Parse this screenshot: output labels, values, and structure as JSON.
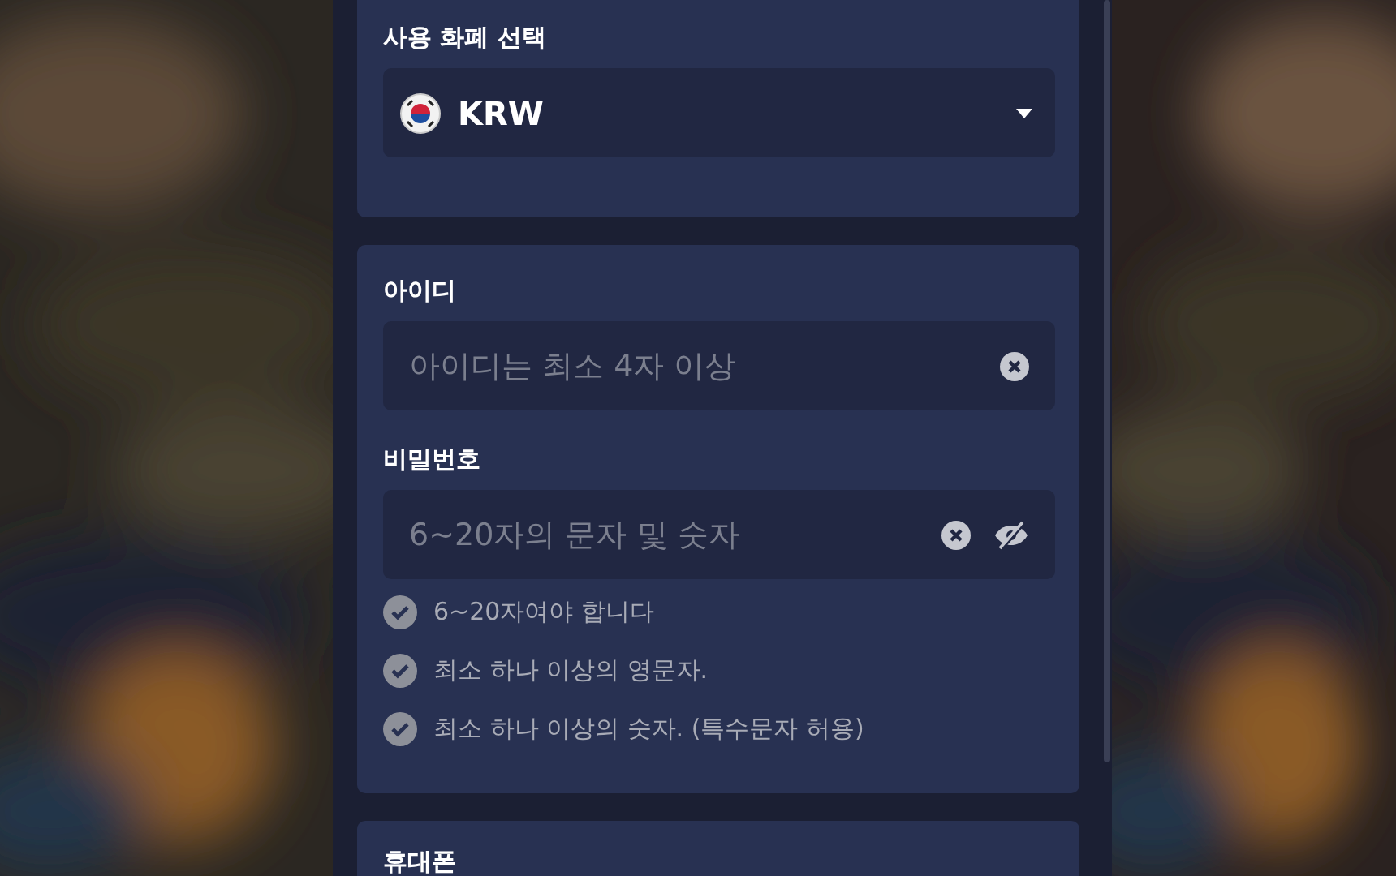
{
  "currency": {
    "label": "사용 화폐 선택",
    "value": "KRW"
  },
  "account": {
    "id_label": "아이디",
    "id_placeholder": "아이디는 최소 4자 이상",
    "password_label": "비밀번호",
    "password_placeholder": "6~20자의 문자 및 숫자",
    "rules": [
      {
        "text": "6~20자여야 합니다",
        "met": false
      },
      {
        "text": "최소 하나 이상의 영문자.",
        "met": false
      },
      {
        "text": "최소 하나 이상의 숫자. (특수문자 허용)",
        "met": false
      }
    ]
  },
  "phone": {
    "label": "휴대폰"
  }
}
